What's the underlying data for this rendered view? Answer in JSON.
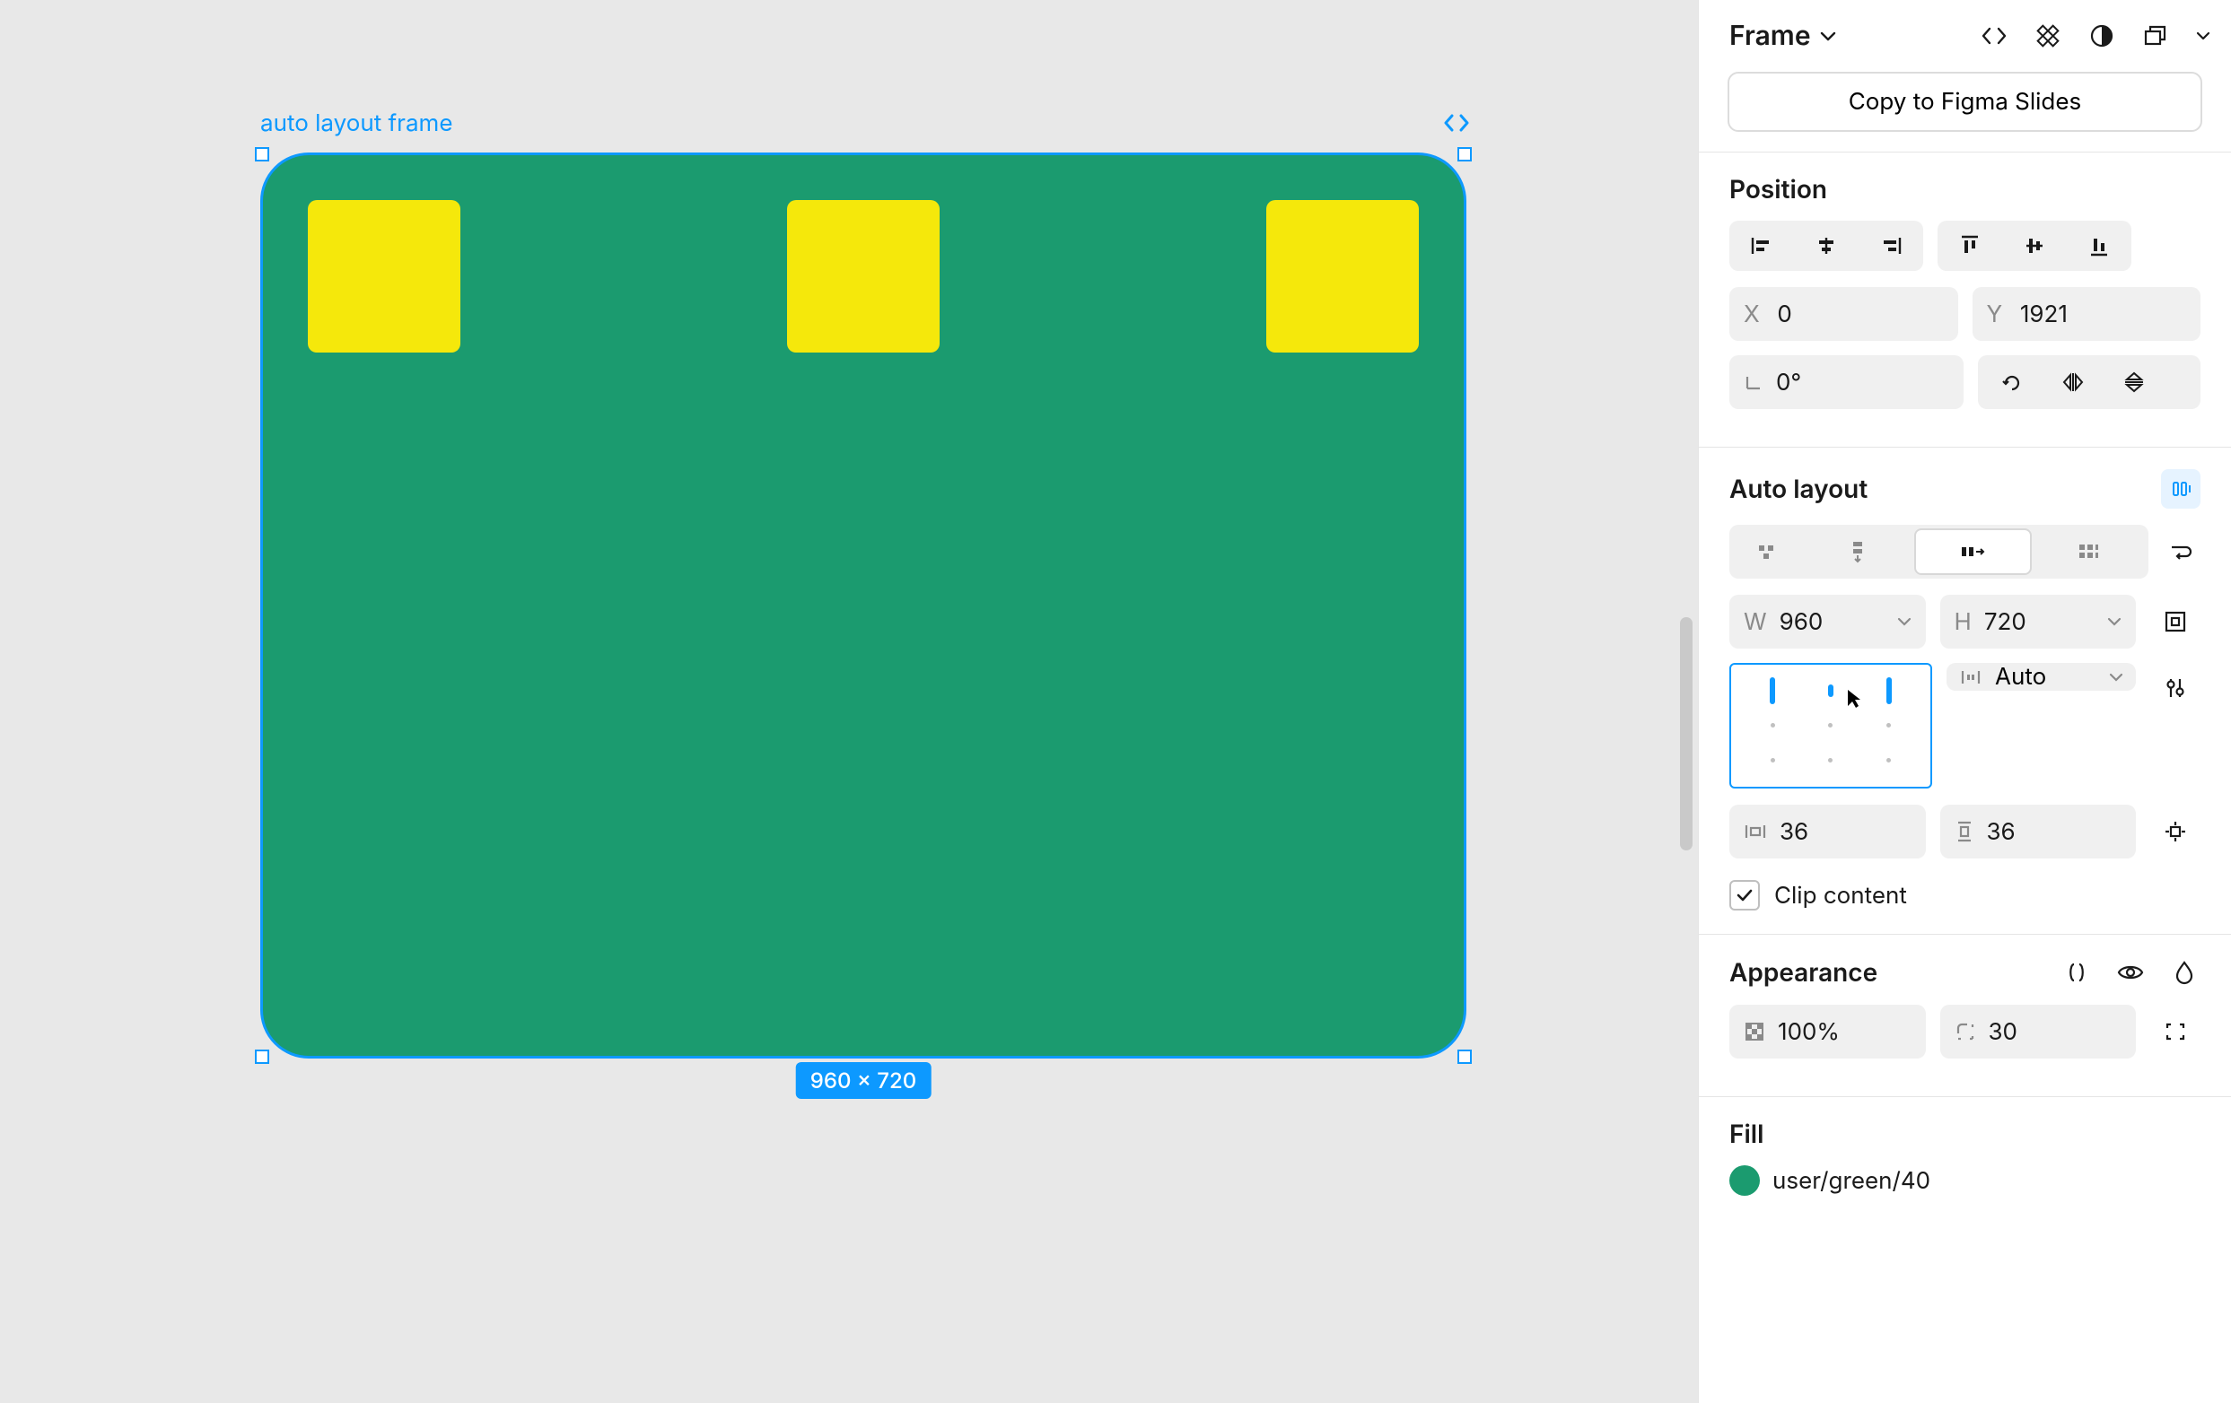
{
  "canvas": {
    "frame_label": "auto layout frame",
    "dim_badge": "960 × 720"
  },
  "panel": {
    "header": {
      "title": "Frame"
    },
    "copy_button": "Copy to Figma Slides",
    "position": {
      "title": "Position",
      "x_label": "X",
      "x_value": "0",
      "y_label": "Y",
      "y_value": "1921",
      "rotation_value": "0°"
    },
    "auto_layout": {
      "title": "Auto layout",
      "w_label": "W",
      "w_value": "960",
      "h_label": "H",
      "h_value": "720",
      "gap_value": "Auto",
      "pad_h_value": "36",
      "pad_v_value": "36",
      "clip_label": "Clip content"
    },
    "appearance": {
      "title": "Appearance",
      "opacity_value": "100%",
      "radius_value": "30"
    },
    "fill": {
      "title": "Fill",
      "swatch_color": "#1b9b6f",
      "color_name": "user/green/40"
    }
  }
}
